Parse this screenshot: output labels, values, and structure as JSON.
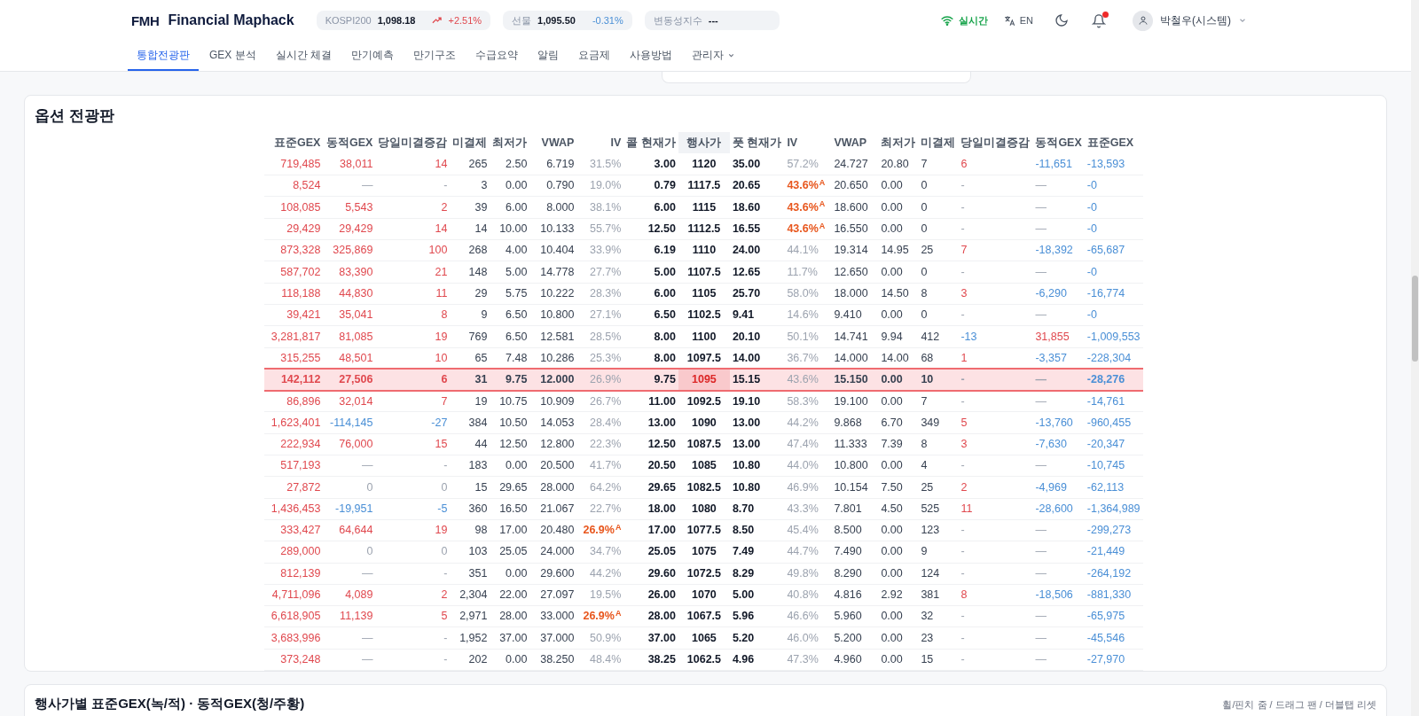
{
  "header": {
    "logo_mark": "FMH",
    "brand": "Financial Maphack",
    "tickers": [
      {
        "label": "KOSPI200",
        "value": "1,098.18",
        "change": "+2.51%",
        "rising": true
      },
      {
        "label": "선물",
        "value": "1,095.50",
        "change": "-0.31%",
        "rising": false
      },
      {
        "label": "변동성지수",
        "value": "---"
      }
    ],
    "status": "실시간",
    "language": "EN",
    "notifications_unread": true,
    "user": "박철우(시스템)"
  },
  "nav": [
    {
      "label": "통합전광판",
      "selected": true
    },
    {
      "label": "GEX 분석",
      "selected": false
    },
    {
      "label": "실시간 체결",
      "selected": false
    },
    {
      "label": "만기예측",
      "selected": false
    },
    {
      "label": "만기구조",
      "selected": false
    },
    {
      "label": "수급요약",
      "selected": false
    },
    {
      "label": "알림",
      "selected": false
    },
    {
      "label": "요금제",
      "selected": false
    },
    {
      "label": "사용방법",
      "selected": false
    },
    {
      "label": "관리자",
      "selected": false,
      "dropdown": true
    }
  ],
  "board": {
    "title": "옵션 전광판",
    "call_columns": [
      "표준GEX",
      "동적GEX",
      "당일미결증감",
      "미결제",
      "최저가",
      "VWAP",
      "IV",
      "콜 현재가"
    ],
    "strike_column": "행사가",
    "put_columns": [
      "풋 현재가",
      "IV",
      "VWAP",
      "최저가",
      "미결제",
      "당일미결증감",
      "동적GEX",
      "표준GEX"
    ],
    "rows": [
      {
        "call": [
          "719,485",
          "38,011",
          "14",
          "265",
          "2.50",
          "6.719",
          "31.5%",
          "3.00"
        ],
        "strike": "1120",
        "put": [
          "35.00",
          "57.2%",
          "24.727",
          "20.80",
          "7",
          "6",
          "-11,651",
          "-13,593"
        ],
        "selected": false
      },
      {
        "call": [
          "8,524",
          "—",
          "-",
          "3",
          "0.00",
          "0.790",
          "19.0%",
          "0.79"
        ],
        "strike": "1117.5",
        "put": [
          "20.65",
          "43.6%",
          "20.650",
          "0.00",
          "0",
          "-",
          "—",
          "-0"
        ],
        "put_flag": "A",
        "selected": false
      },
      {
        "call": [
          "108,085",
          "5,543",
          "2",
          "39",
          "6.00",
          "8.000",
          "38.1%",
          "6.00"
        ],
        "strike": "1115",
        "put": [
          "18.60",
          "43.6%",
          "18.600",
          "0.00",
          "0",
          "-",
          "—",
          "-0"
        ],
        "put_flag": "A",
        "selected": false
      },
      {
        "call": [
          "29,429",
          "29,429",
          "14",
          "14",
          "10.00",
          "10.133",
          "55.7%",
          "12.50"
        ],
        "strike": "1112.5",
        "put": [
          "16.55",
          "43.6%",
          "16.550",
          "0.00",
          "0",
          "-",
          "—",
          "-0"
        ],
        "put_flag": "A",
        "selected": false
      },
      {
        "call": [
          "873,328",
          "325,869",
          "100",
          "268",
          "4.00",
          "10.404",
          "33.9%",
          "6.19"
        ],
        "strike": "1110",
        "put": [
          "24.00",
          "44.1%",
          "19.314",
          "14.95",
          "25",
          "7",
          "-18,392",
          "-65,687"
        ],
        "selected": false
      },
      {
        "call": [
          "587,702",
          "83,390",
          "21",
          "148",
          "5.00",
          "14.778",
          "27.7%",
          "5.00"
        ],
        "strike": "1107.5",
        "put": [
          "12.65",
          "11.7%",
          "12.650",
          "0.00",
          "0",
          "-",
          "—",
          "-0"
        ],
        "selected": false
      },
      {
        "call": [
          "118,188",
          "44,830",
          "11",
          "29",
          "5.75",
          "10.222",
          "28.3%",
          "6.00"
        ],
        "strike": "1105",
        "put": [
          "25.70",
          "58.0%",
          "18.000",
          "14.50",
          "8",
          "3",
          "-6,290",
          "-16,774"
        ],
        "selected": false
      },
      {
        "call": [
          "39,421",
          "35,041",
          "8",
          "9",
          "6.50",
          "10.800",
          "27.1%",
          "6.50"
        ],
        "strike": "1102.5",
        "put": [
          "9.41",
          "14.6%",
          "9.410",
          "0.00",
          "0",
          "-",
          "—",
          "-0"
        ],
        "selected": false
      },
      {
        "call": [
          "3,281,817",
          "81,085",
          "19",
          "769",
          "6.50",
          "12.581",
          "28.5%",
          "8.00"
        ],
        "strike": "1100",
        "put": [
          "20.10",
          "50.1%",
          "14.741",
          "9.94",
          "412",
          "-13",
          "31,855",
          "-1,009,553"
        ],
        "selected": false
      },
      {
        "call": [
          "315,255",
          "48,501",
          "10",
          "65",
          "7.48",
          "10.286",
          "25.3%",
          "8.00"
        ],
        "strike": "1097.5",
        "put": [
          "14.00",
          "36.7%",
          "14.000",
          "14.00",
          "68",
          "1",
          "-3,357",
          "-228,304"
        ],
        "selected": false
      },
      {
        "call": [
          "142,112",
          "27,506",
          "6",
          "31",
          "9.75",
          "12.000",
          "26.9%",
          "9.75"
        ],
        "strike": "1095",
        "put": [
          "15.15",
          "43.6%",
          "15.150",
          "0.00",
          "10",
          "-",
          "—",
          "-28,276"
        ],
        "selected": true
      },
      {
        "call": [
          "86,896",
          "32,014",
          "7",
          "19",
          "10.75",
          "10.909",
          "26.7%",
          "11.00"
        ],
        "strike": "1092.5",
        "put": [
          "19.10",
          "58.3%",
          "19.100",
          "0.00",
          "7",
          "-",
          "—",
          "-14,761"
        ],
        "selected": false
      },
      {
        "call": [
          "1,623,401",
          "-114,145",
          "-27",
          "384",
          "10.50",
          "14.053",
          "28.4%",
          "13.00"
        ],
        "strike": "1090",
        "put": [
          "13.00",
          "44.2%",
          "9.868",
          "6.70",
          "349",
          "5",
          "-13,760",
          "-960,455"
        ],
        "selected": false
      },
      {
        "call": [
          "222,934",
          "76,000",
          "15",
          "44",
          "12.50",
          "12.800",
          "22.3%",
          "12.50"
        ],
        "strike": "1087.5",
        "put": [
          "13.00",
          "47.4%",
          "11.333",
          "7.39",
          "8",
          "3",
          "-7,630",
          "-20,347"
        ],
        "selected": false
      },
      {
        "call": [
          "517,193",
          "—",
          "-",
          "183",
          "0.00",
          "20.500",
          "41.7%",
          "20.50"
        ],
        "strike": "1085",
        "put": [
          "10.80",
          "44.0%",
          "10.800",
          "0.00",
          "4",
          "-",
          "—",
          "-10,745"
        ],
        "selected": false
      },
      {
        "call": [
          "27,872",
          "0",
          "0",
          "15",
          "29.65",
          "28.000",
          "64.2%",
          "29.65"
        ],
        "strike": "1082.5",
        "put": [
          "10.80",
          "46.9%",
          "10.154",
          "7.50",
          "25",
          "2",
          "-4,969",
          "-62,113"
        ],
        "selected": false
      },
      {
        "call": [
          "1,436,453",
          "-19,951",
          "-5",
          "360",
          "16.50",
          "21.067",
          "22.7%",
          "18.00"
        ],
        "strike": "1080",
        "put": [
          "8.70",
          "43.3%",
          "7.801",
          "4.50",
          "525",
          "11",
          "-28,600",
          "-1,364,989"
        ],
        "selected": false
      },
      {
        "call": [
          "333,427",
          "64,644",
          "19",
          "98",
          "17.00",
          "20.480",
          "26.9%",
          "17.00"
        ],
        "call_flag": "A",
        "strike": "1077.5",
        "put": [
          "8.50",
          "45.4%",
          "8.500",
          "0.00",
          "123",
          "-",
          "—",
          "-299,273"
        ],
        "selected": false
      },
      {
        "call": [
          "289,000",
          "0",
          "0",
          "103",
          "25.05",
          "24.000",
          "34.7%",
          "25.05"
        ],
        "strike": "1075",
        "put": [
          "7.49",
          "44.7%",
          "7.490",
          "0.00",
          "9",
          "-",
          "—",
          "-21,449"
        ],
        "selected": false
      },
      {
        "call": [
          "812,139",
          "—",
          "-",
          "351",
          "0.00",
          "29.600",
          "44.2%",
          "29.60"
        ],
        "strike": "1072.5",
        "put": [
          "8.29",
          "49.8%",
          "8.290",
          "0.00",
          "124",
          "-",
          "—",
          "-264,192"
        ],
        "selected": false
      },
      {
        "call": [
          "4,711,096",
          "4,089",
          "2",
          "2,304",
          "22.00",
          "27.097",
          "19.5%",
          "26.00"
        ],
        "strike": "1070",
        "put": [
          "5.00",
          "40.8%",
          "4.816",
          "2.92",
          "381",
          "8",
          "-18,506",
          "-881,330"
        ],
        "selected": false
      },
      {
        "call": [
          "6,618,905",
          "11,139",
          "5",
          "2,971",
          "28.00",
          "33.000",
          "26.9%",
          "28.00"
        ],
        "call_flag": "A",
        "strike": "1067.5",
        "put": [
          "5.96",
          "46.6%",
          "5.960",
          "0.00",
          "32",
          "-",
          "—",
          "-65,975"
        ],
        "selected": false
      },
      {
        "call": [
          "3,683,996",
          "—",
          "-",
          "1,952",
          "37.00",
          "37.000",
          "50.9%",
          "37.00"
        ],
        "strike": "1065",
        "put": [
          "5.20",
          "46.0%",
          "5.200",
          "0.00",
          "23",
          "-",
          "—",
          "-45,546"
        ],
        "selected": false
      },
      {
        "call": [
          "373,248",
          "—",
          "-",
          "202",
          "0.00",
          "38.250",
          "48.4%",
          "38.25"
        ],
        "strike": "1062.5",
        "put": [
          "4.96",
          "47.3%",
          "4.960",
          "0.00",
          "15",
          "-",
          "—",
          "-27,970"
        ],
        "selected": false
      }
    ]
  },
  "chart_card": {
    "title": "행사가별 표준GEX(녹/적) · 동적GEX(청/주황)",
    "hint": "휠/핀치 줌 / 드래그 팬 / 더블탭 리셋"
  }
}
